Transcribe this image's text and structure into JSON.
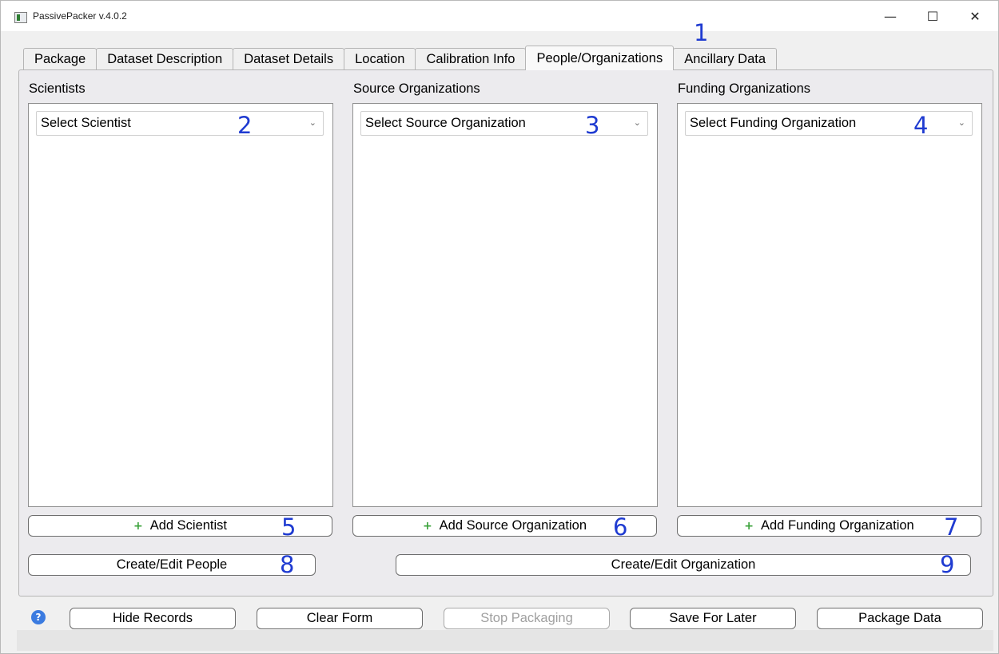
{
  "window": {
    "title": "PassivePacker v.4.0.2",
    "controls": {
      "minimize": "—",
      "maximize": "☐",
      "close": "✕"
    }
  },
  "tabs": [
    {
      "label": "Package"
    },
    {
      "label": "Dataset Description"
    },
    {
      "label": "Dataset Details"
    },
    {
      "label": "Location"
    },
    {
      "label": "Calibration Info"
    },
    {
      "label": "People/Organizations",
      "active": true
    },
    {
      "label": "Ancillary Data"
    }
  ],
  "columns": {
    "scientists": {
      "label": "Scientists",
      "combo": "Select Scientist",
      "add_button": "Add Scientist"
    },
    "source": {
      "label": "Source Organizations",
      "combo": "Select Source Organization",
      "add_button": "Add Source Organization"
    },
    "funding": {
      "label": "Funding Organizations",
      "combo": "Select Funding Organization",
      "add_button": "Add Funding Organization"
    }
  },
  "actions": {
    "edit_people": "Create/Edit People",
    "edit_organization": "Create/Edit Organization"
  },
  "footer": {
    "hide_records": "Hide Records",
    "clear_form": "Clear Form",
    "stop_packaging": "Stop Packaging",
    "save_for_later": "Save For Later",
    "package_data": "Package Data"
  },
  "annotations": [
    "1",
    "2",
    "3",
    "4",
    "5",
    "6",
    "7",
    "8",
    "9"
  ],
  "icons": {
    "plus": "+",
    "help": "?",
    "chevron": "⌄"
  },
  "colors": {
    "annotation": "#1f3bd1",
    "add_icon": "#3aa23a",
    "help_icon": "#3b7be0"
  }
}
